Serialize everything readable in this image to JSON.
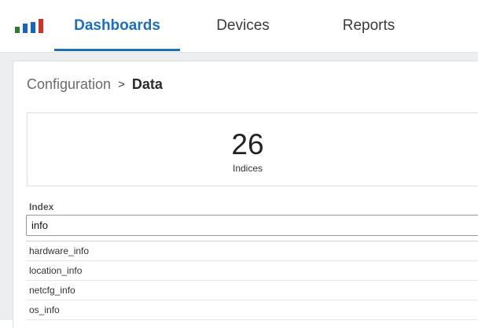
{
  "nav": {
    "tabs": [
      {
        "label": "Dashboards",
        "active": true
      },
      {
        "label": "Devices",
        "active": false
      },
      {
        "label": "Reports",
        "active": false
      }
    ],
    "accent_color": "#1f6fb2"
  },
  "logo": {
    "icon": "bar-chart-logo-icon",
    "bar_colors": [
      "#2e7d32",
      "#1565c0",
      "#1565c0",
      "#d32f2f"
    ]
  },
  "breadcrumb": {
    "parent": "Configuration",
    "separator": ">",
    "current": "Data"
  },
  "stat": {
    "value": "26",
    "label": "Indices"
  },
  "index_field": {
    "label": "Index",
    "value": "info",
    "placeholder": ""
  },
  "suggestions": [
    "hardware_info",
    "location_info",
    "netcfg_info",
    "os_info"
  ]
}
